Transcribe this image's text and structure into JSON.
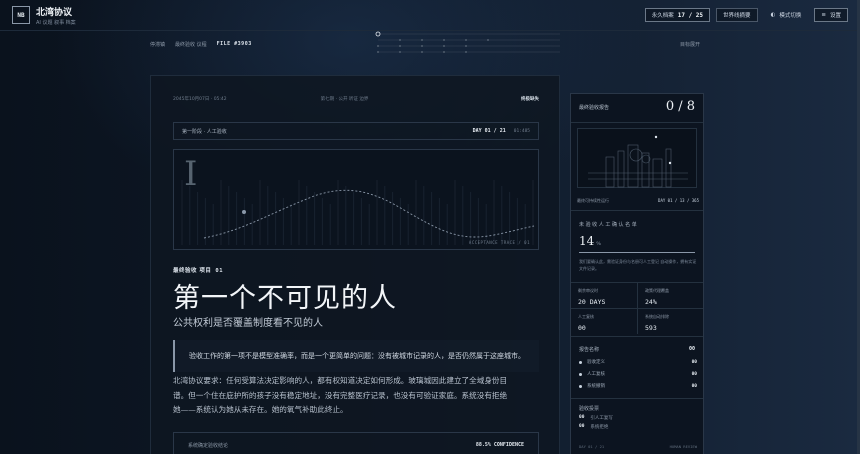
{
  "brand": {
    "logo": "NB",
    "title": "北湾协议",
    "subtitle": "AI 议题 叙事 档案"
  },
  "topbar": {
    "archive_label": "永久档案",
    "archive_count": "17 / 25",
    "summary_label": "世界线摘要",
    "mode_label": "模式切换",
    "settings_label": "设置"
  },
  "subnav": {
    "crumb_1": "停滞镇",
    "crumb_2": "最终验收 议程",
    "file": "FILE #3903",
    "right": "目标展开"
  },
  "article": {
    "date": "2045年10月07日 · 05:42",
    "center_meta": "第七期 · 公开 听证 边界",
    "right_meta": "终极缺失",
    "stage_label": "第一阶段 · 人工验收",
    "day": "DAY 01 / 21",
    "sec": "01:485",
    "plot_letter": "I",
    "plot_caption": "ACCEPTANCE TRACE / 01",
    "kicker": "最终验收 项目",
    "kicker_num": "01",
    "title": "第一个不可见的人",
    "subtitle": "公共权利是否覆盖制度看不见的人",
    "quote": "验收工作的第一项不是模型准确率，而是一个更简单的问题：没有被城市记录的人，是否仍然属于这座城市。",
    "para_1": "北湾协议要求：任何受算法决定影响的人，都有权知道决定如何形成。玻璃城因此建立了全域身份目",
    "para_2": "谱。但一个住在庇护所的孩子没有稳定地址，没有完整医疗记录，也没有可验证家庭。系统没有拒绝",
    "para_3": "她——系统认为她从未存在。她的氧气补助此终止。",
    "bottom_label": "系统确定验收结论",
    "confidence": "88.5% CONFIDENCE"
  },
  "side": {
    "head": "最终验收报告",
    "count": "0 / 8",
    "caption_left": "最终可持续性运行",
    "caption_right": "DAY 01 / 13 / 365",
    "section_title": "未 验 收 人 工 确 认 名 单",
    "big_value": "14",
    "big_unit": "%",
    "note": "我们要确认此，需验证身份与名册可人工登记 自动操作，拥有实证文件记录。",
    "stats": [
      {
        "label": "剩余审议时",
        "value": "20 DAYS"
      },
      {
        "label": "政策代理覆盖",
        "value": "24%"
      },
      {
        "label": "人工复核",
        "value": "00"
      },
      {
        "label": "系统自动排除",
        "value": "593"
      }
    ],
    "report_title": "报告名称",
    "report_count": "00",
    "reports": [
      {
        "label": "验收定义",
        "value": "00"
      },
      {
        "label": "人工复核",
        "value": "00"
      },
      {
        "label": "系统撤销",
        "value": "00"
      }
    ],
    "vote_title": "验收投票",
    "votes": [
      {
        "value": "00",
        "label": "引人工复写"
      },
      {
        "value": "00",
        "label": "系统拒绝"
      }
    ],
    "foot_left": "DAY 01 / 21",
    "foot_right": "HUMAN REVIEW"
  },
  "colors": {
    "background": "#0c1522",
    "accent": "#8a97a8",
    "text": "#c9d3df"
  }
}
